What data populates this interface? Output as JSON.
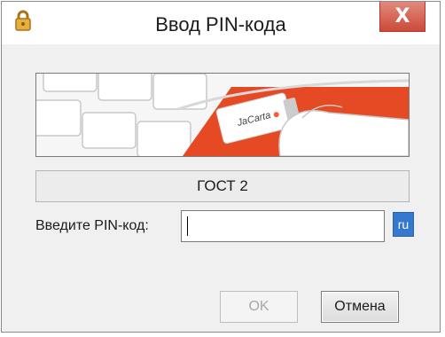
{
  "window": {
    "title": "Ввод PIN-кода",
    "icon": "lock-icon",
    "close_label": "X"
  },
  "banner": {
    "card_brand": "JaCarta",
    "accent_color": "#e54a24"
  },
  "token": {
    "name": "ГОСТ 2"
  },
  "pin": {
    "label": "Введите PIN-код:",
    "value": "",
    "language_indicator": "ru"
  },
  "buttons": {
    "ok_label": "OK",
    "cancel_label": "Отмена"
  }
}
